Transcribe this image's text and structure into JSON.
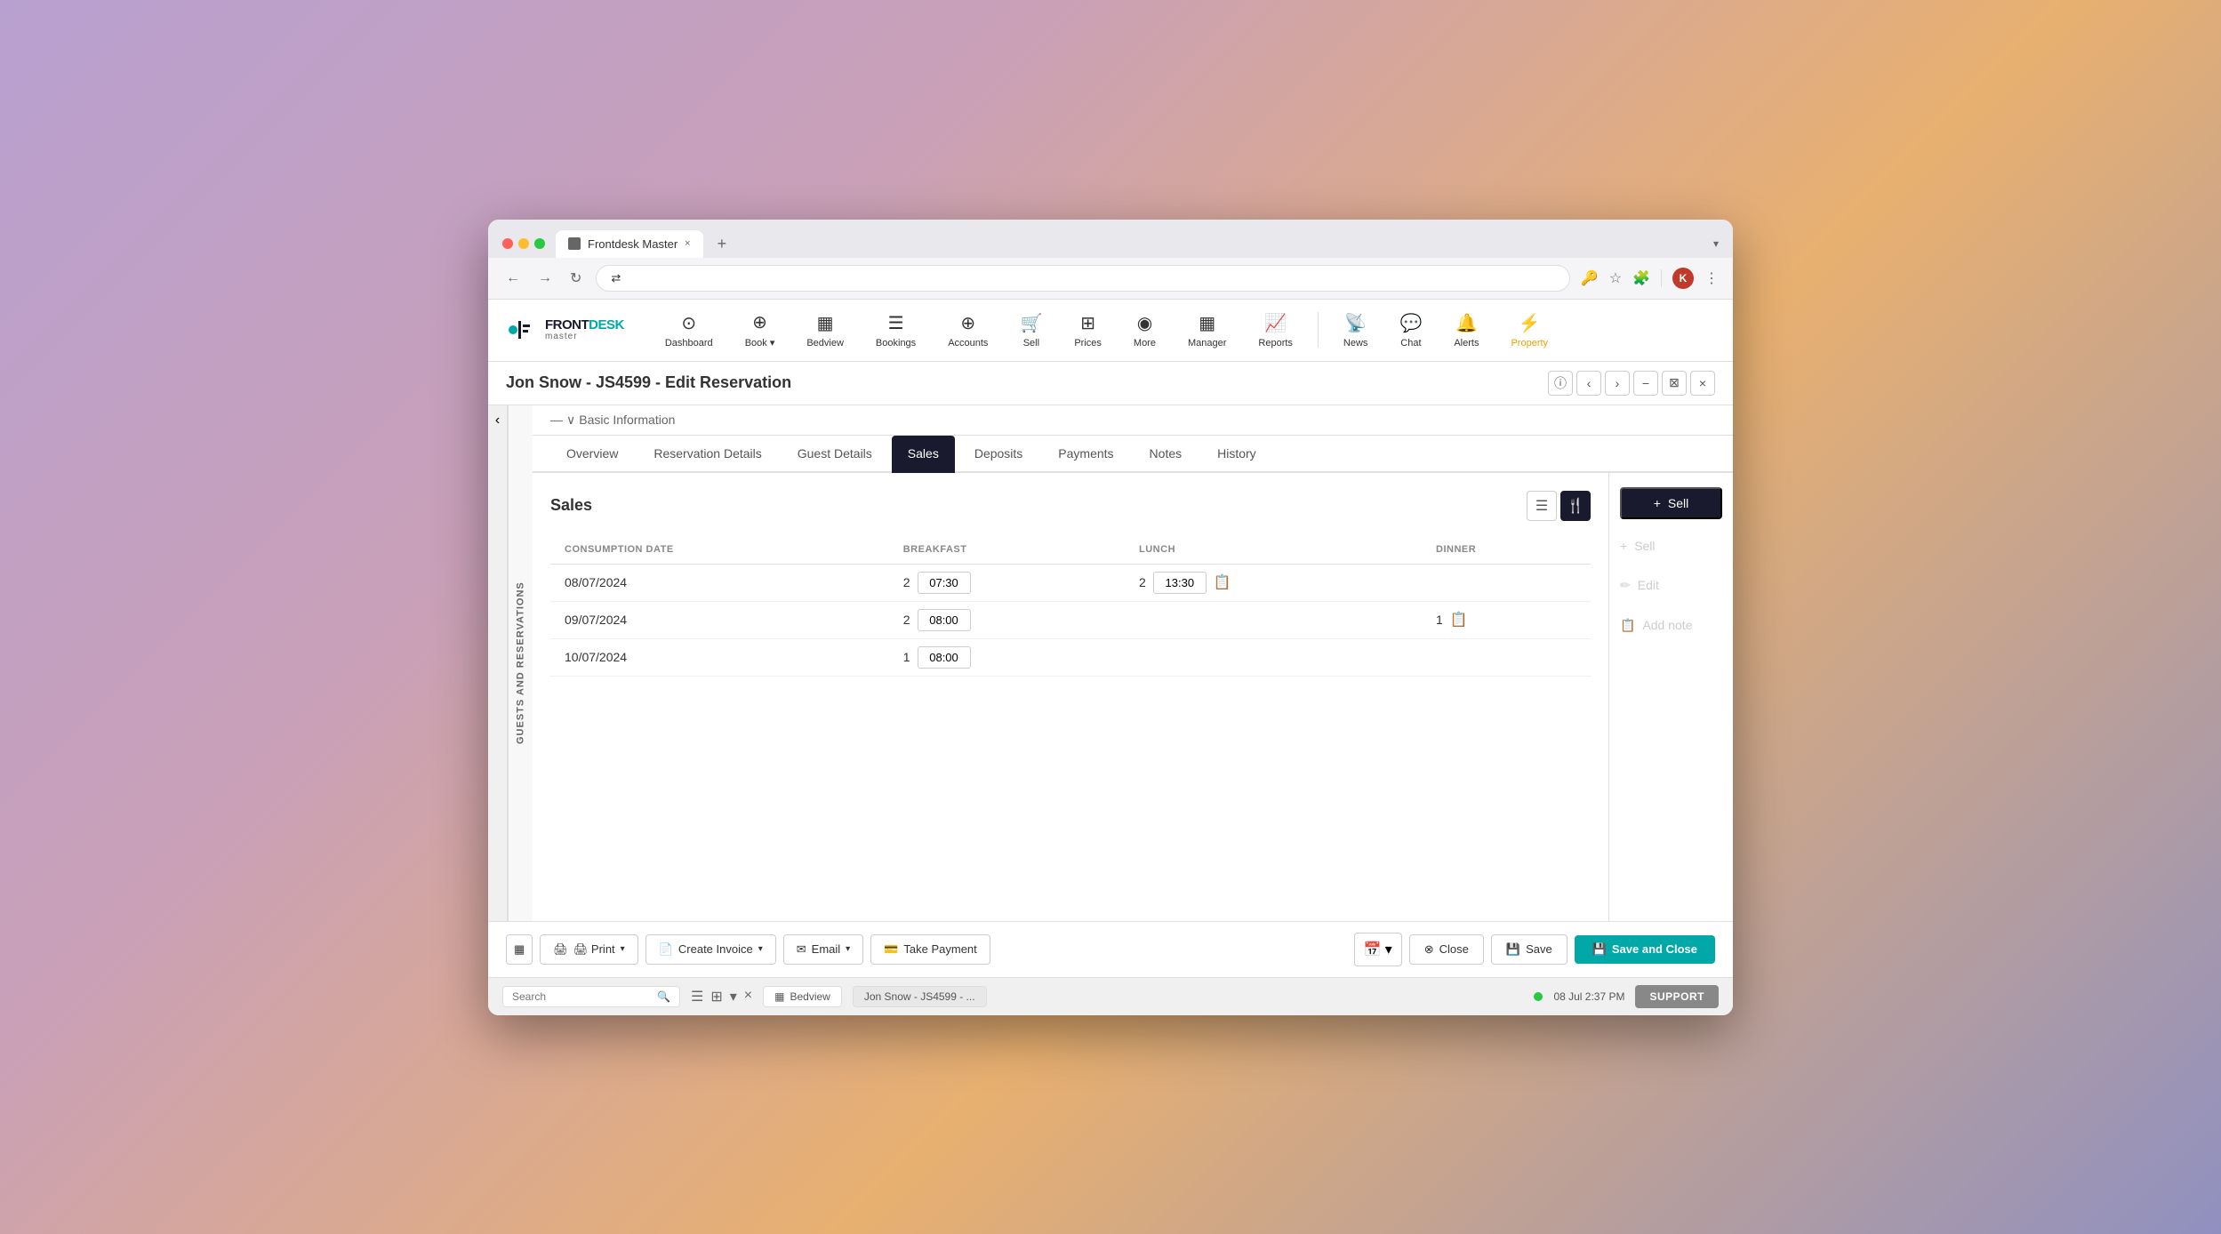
{
  "browser": {
    "tab_title": "Frontdesk Master",
    "tab_close": "×",
    "tab_new": "+",
    "tab_dropdown": "▾",
    "back_btn": "←",
    "forward_btn": "→",
    "refresh_btn": "↻",
    "address_icon": "⇄",
    "address_url": "",
    "key_icon": "🔑",
    "star_icon": "☆",
    "ext_icon": "🧩",
    "user_initial": "K",
    "menu_icon": "⋮"
  },
  "nav": {
    "logo_text_front": "FRONT",
    "logo_text_desk": "DESK",
    "logo_sub": "master",
    "items": [
      {
        "id": "dashboard",
        "icon": "⊙",
        "label": "Dashboard"
      },
      {
        "id": "book",
        "icon": "⊕",
        "label": "Book",
        "has_chevron": true
      },
      {
        "id": "bedview",
        "icon": "▦",
        "label": "Bedview"
      },
      {
        "id": "bookings",
        "icon": "☰",
        "label": "Bookings"
      },
      {
        "id": "accounts",
        "icon": "⊕",
        "label": "Accounts"
      },
      {
        "id": "sell",
        "icon": "🛒",
        "label": "Sell"
      },
      {
        "id": "prices",
        "icon": "⊞",
        "label": "Prices"
      },
      {
        "id": "more",
        "icon": "◉",
        "label": "More"
      },
      {
        "id": "manager",
        "icon": "▦",
        "label": "Manager"
      },
      {
        "id": "reports",
        "icon": "📈",
        "label": "Reports"
      }
    ],
    "right_items": [
      {
        "id": "news",
        "icon": "📡",
        "label": "News"
      },
      {
        "id": "chat",
        "icon": "💬",
        "label": "Chat"
      },
      {
        "id": "alerts",
        "icon": "🔔",
        "label": "Alerts"
      },
      {
        "id": "property",
        "icon": "⚡",
        "label": "Property"
      }
    ]
  },
  "page": {
    "title": "Jon Snow - JS4599 - Edit Reservation",
    "basic_info_label": "Basic Information",
    "sidebar_label": "GUESTS AND RESERVATIONS",
    "header_btns": [
      "ⓘ",
      "‹",
      "›",
      "−",
      "⊠",
      "×"
    ]
  },
  "tabs": [
    {
      "id": "overview",
      "label": "Overview",
      "active": false
    },
    {
      "id": "reservation-details",
      "label": "Reservation Details",
      "active": false
    },
    {
      "id": "guest-details",
      "label": "Guest Details",
      "active": false
    },
    {
      "id": "sales",
      "label": "Sales",
      "active": true
    },
    {
      "id": "deposits",
      "label": "Deposits",
      "active": false
    },
    {
      "id": "payments",
      "label": "Payments",
      "active": false
    },
    {
      "id": "notes",
      "label": "Notes",
      "active": false
    },
    {
      "id": "history",
      "label": "History",
      "active": false
    }
  ],
  "sales": {
    "title": "Sales",
    "columns": {
      "consumption_date": "CONSUMPTION DATE",
      "breakfast": "BREAKFAST",
      "lunch": "LUNCH",
      "dinner": "DINNER"
    },
    "rows": [
      {
        "date": "08/07/2024",
        "breakfast_count": "2",
        "breakfast_time": "07:30",
        "lunch_count": "2",
        "lunch_time": "13:30",
        "lunch_copy": true,
        "dinner_count": "",
        "dinner_copy": false
      },
      {
        "date": "09/07/2024",
        "breakfast_count": "2",
        "breakfast_time": "08:00",
        "lunch_count": "",
        "lunch_time": "",
        "lunch_copy": false,
        "dinner_count": "1",
        "dinner_copy": true
      },
      {
        "date": "10/07/2024",
        "breakfast_count": "1",
        "breakfast_time": "08:00",
        "lunch_count": "",
        "lunch_time": "",
        "lunch_copy": false,
        "dinner_count": "",
        "dinner_copy": false
      }
    ],
    "right_actions": {
      "sell_primary": "+ Sell",
      "sell_secondary": "+ Sell",
      "edit": "✏ Edit",
      "add_note": "📋 Add note"
    }
  },
  "footer": {
    "grid_icon": "▦",
    "print_label": "🖨 Print",
    "create_invoice_label": "📄 Create Invoice",
    "email_label": "✉ Email",
    "take_payment_label": "💳 Take Payment",
    "close_label": "Close",
    "save_label": "Save",
    "save_close_label": "Save and Close",
    "calendar_icon": "📅"
  },
  "statusbar": {
    "search_placeholder": "Search",
    "search_icon": "🔍",
    "icon_list": "☰",
    "icon_grid": "⊞",
    "icon_chevron": "▾",
    "icon_close": "×",
    "bedview_label": "Bedview",
    "bedview_icon": "▦",
    "reservation_tag": "Jon Snow - JS4599 - ...",
    "time_label": "08 Jul 2:37 PM",
    "support_label": "SUPPORT",
    "online_status": true
  }
}
